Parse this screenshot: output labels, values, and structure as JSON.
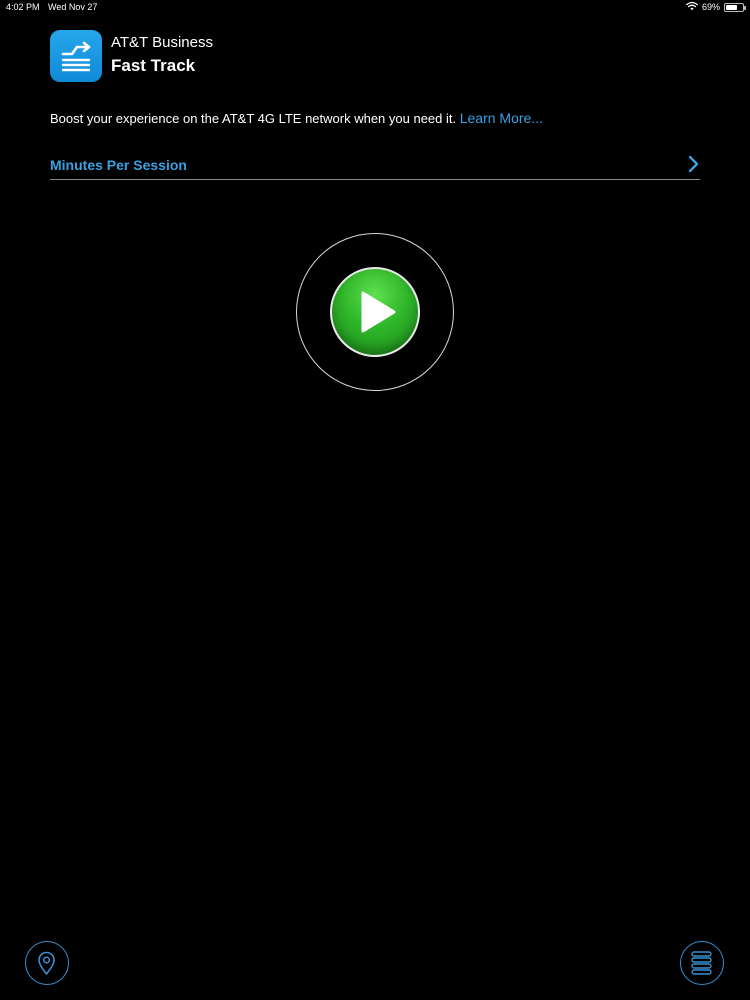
{
  "status_bar": {
    "time": "4:02 PM",
    "date": "Wed Nov 27",
    "battery": "69%",
    "battery_level": 0.69,
    "wifi_icon": "wifi-icon"
  },
  "header": {
    "app_icon": "fast-track-app-icon",
    "brand": "AT&T Business",
    "product": "Fast Track"
  },
  "description": {
    "text": "Boost your experience on the AT&T 4G LTE network when you need it. ",
    "link": "Learn More..."
  },
  "session": {
    "label": "Minutes Per Session",
    "chevron_icon": "chevron-right-icon"
  },
  "play": {
    "icon": "play-icon"
  },
  "bottom": {
    "location_icon": "location-pin-icon",
    "menu_icon": "menu-list-icon"
  },
  "colors": {
    "background": "#000000",
    "accent_blue": "#3aa0e0",
    "play_green": "#2fb52a",
    "app_icon_blue": "#1d9be3"
  }
}
